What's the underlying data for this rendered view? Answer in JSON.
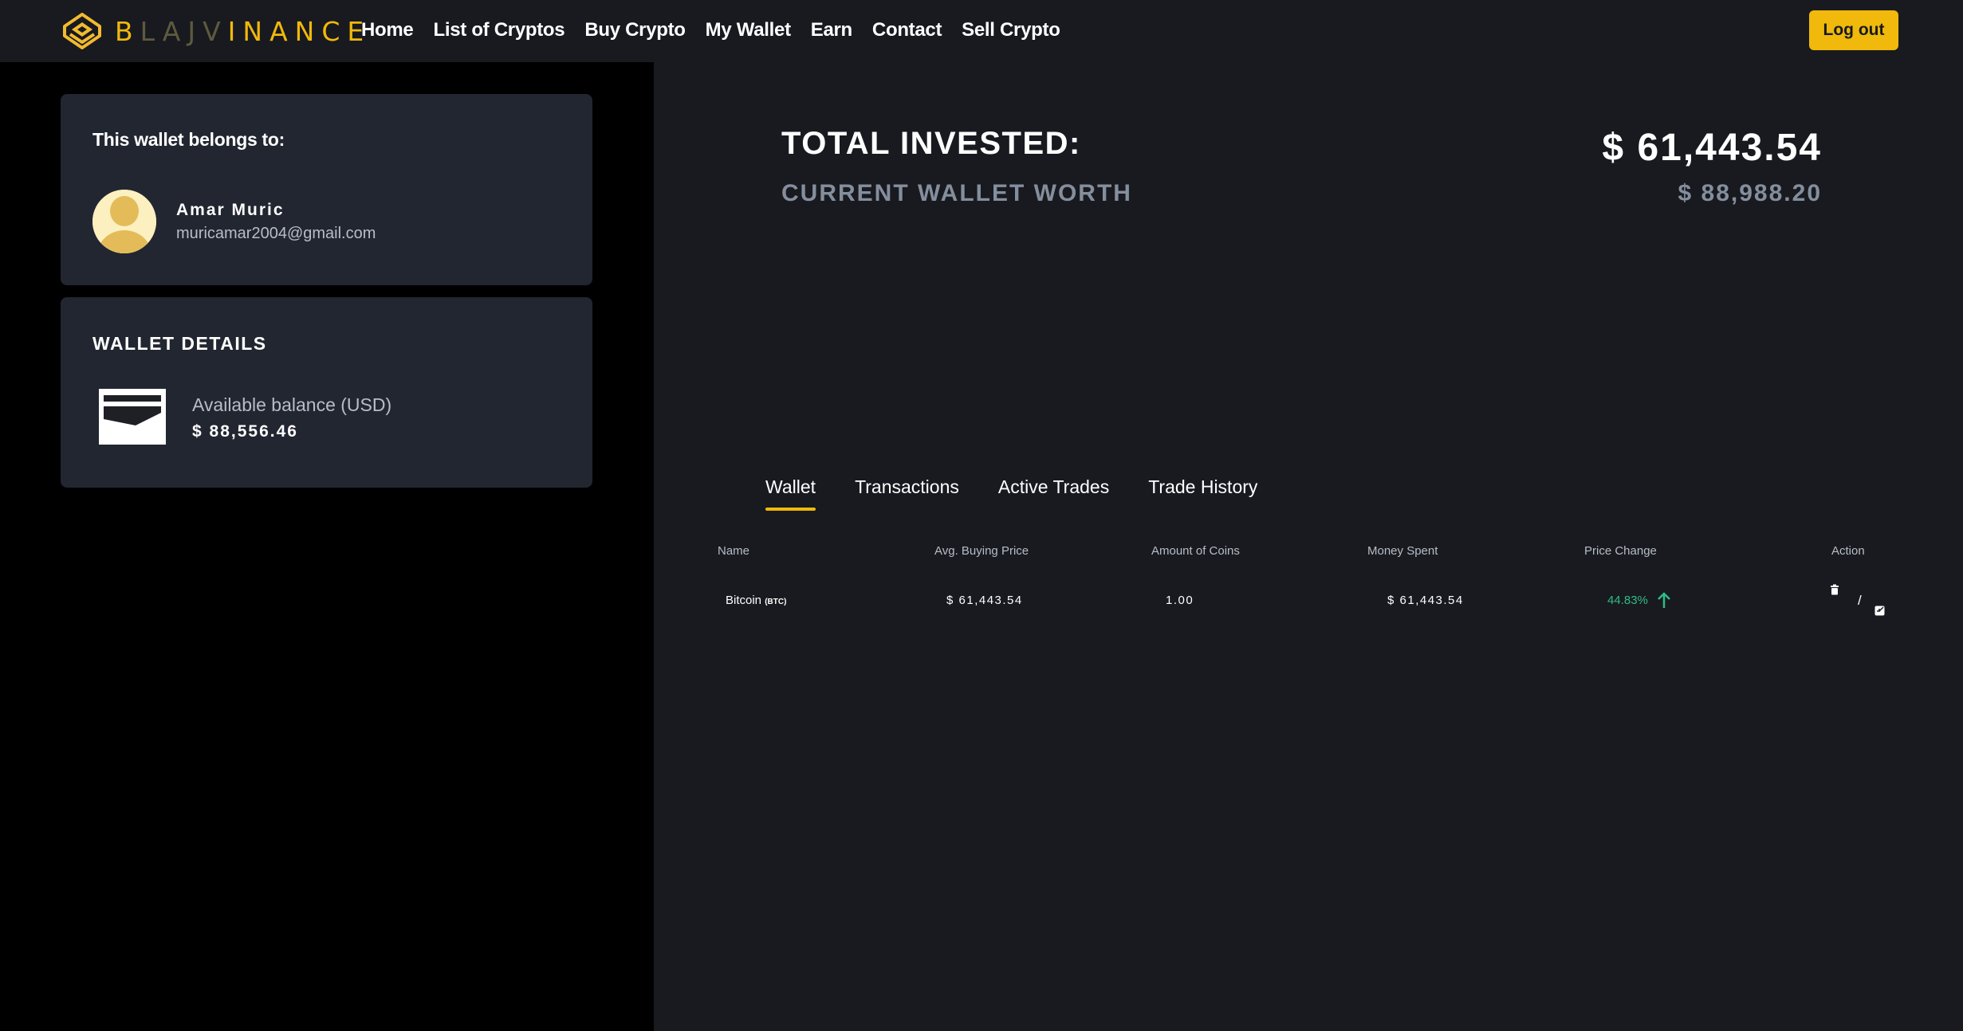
{
  "brand": {
    "letters": [
      "B",
      "LAJV",
      "INANCE"
    ],
    "accent_color": "#f0b90b",
    "logo_icon": "binance-diamond-logo-icon"
  },
  "nav": {
    "items": [
      "Home",
      "List of Cryptos",
      "Buy Crypto",
      "My Wallet",
      "Earn",
      "Contact",
      "Sell Crypto"
    ],
    "logout_label": "Log out"
  },
  "owner": {
    "title": "This wallet belongs to:",
    "name": "Amar  Muric",
    "email": "muricamar2004@gmail.com",
    "avatar_icon": "user-avatar-icon"
  },
  "wallet_details": {
    "title": "WALLET DETAILS",
    "balance_label": "Available balance (USD)",
    "balance_value": "$ 88,556.46",
    "icon": "wallet-icon"
  },
  "summary": {
    "total_invested_label": "TOTAL INVESTED:",
    "total_invested_value": "$ 61,443.54",
    "current_worth_label": "CURRENT WALLET WORTH",
    "current_worth_value": "$ 88,988.20"
  },
  "tabs": [
    "Wallet",
    "Transactions",
    "Active  Trades",
    "Trade History"
  ],
  "table": {
    "headers": [
      "Name",
      "Avg. Buying Price",
      "Amount  of Coins",
      "Money  Spent",
      "Price Change",
      "Action"
    ],
    "rows": [
      {
        "name": "Bitcoin",
        "symbol": "(BTC)",
        "avg_price": "$ 61,443.54",
        "amount": "1.00",
        "money_spent": "$ 61,443.54",
        "price_change": "44.83%",
        "change_direction": "up",
        "action_separator": "/",
        "action_icons": [
          "trash-icon",
          "edit-icon"
        ]
      }
    ]
  },
  "colors": {
    "positive": "#2ebd85",
    "muted": "#848e9c",
    "panel": "#222630",
    "background": "#181a20"
  }
}
